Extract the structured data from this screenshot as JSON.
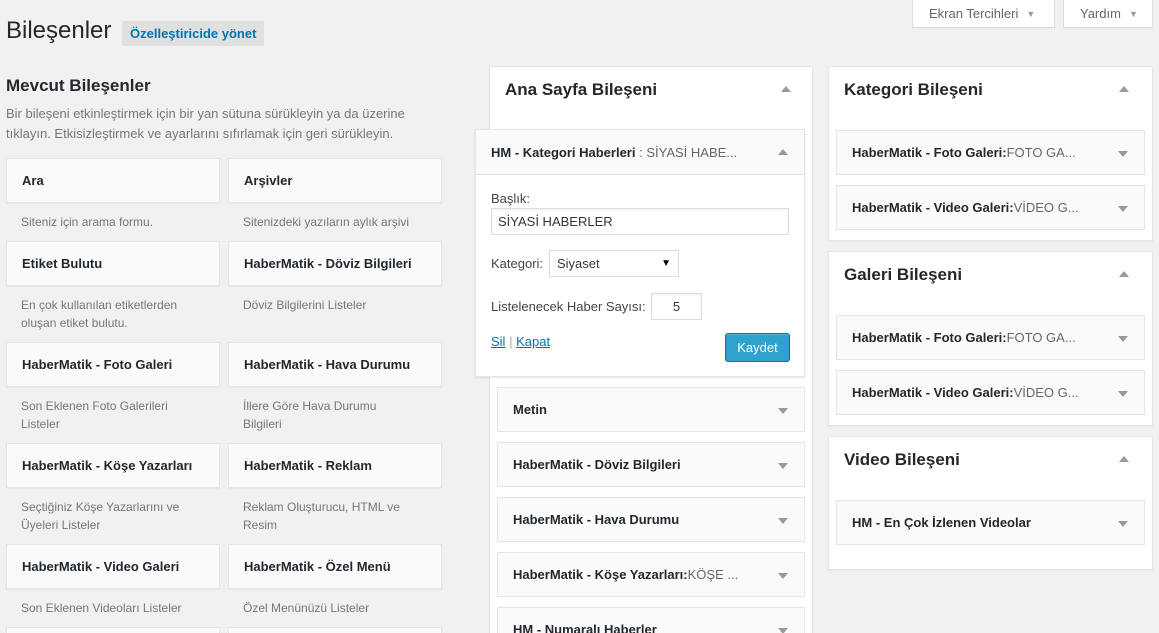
{
  "header": {
    "title": "Bileşenler",
    "manage_label": "Özelleştiricide yönet",
    "screen_options_label": "Ekran Tercihleri",
    "help_label": "Yardım"
  },
  "available": {
    "title": "Mevcut Bileşenler",
    "description": "Bir bileşeni etkinleştirmek için bir yan sütuna sürükleyin ya da üzerine tıklayın. Etkisizleştirmek ve ayarlarını sıfırlamak için geri sürükleyin.",
    "widgets": [
      {
        "name": "Ara",
        "desc": "Siteniz için arama formu."
      },
      {
        "name": "Arşivler",
        "desc": "Sitenizdeki yazıların aylık arşivi"
      },
      {
        "name": "Etiket Bulutu",
        "desc": "En çok kullanılan etiketlerden oluşan etiket bulutu."
      },
      {
        "name": "HaberMatik - Döviz Bilgileri",
        "desc": "Döviz Bilgilerini Listeler"
      },
      {
        "name": "HaberMatik - Foto Galeri",
        "desc": "Son Eklenen Foto Galerileri Listeler"
      },
      {
        "name": "HaberMatik - Hava Durumu",
        "desc": "İllere Göre Hava Durumu Bilgileri"
      },
      {
        "name": "HaberMatik - Köşe Yazarları",
        "desc": "Seçtiğiniz Köşe Yazarlarını ve Üyeleri Listeler"
      },
      {
        "name": "HaberMatik - Reklam",
        "desc": "Reklam Oluşturucu, HTML ve Resim"
      },
      {
        "name": "HaberMatik - Video Galeri",
        "desc": "Son Eklenen Videoları Listeler"
      },
      {
        "name": "HaberMatik - Özel Menü",
        "desc": "Özel Menünüzü Listeler"
      }
    ]
  },
  "home_sidebar": {
    "title": "Ana Sayfa Bileşeni",
    "expanded": {
      "title": "HM - Kategori Haberleri",
      "subtitle": ": SİYASİ HABE...",
      "title_label": "Başlık:",
      "title_value": "SİYASİ HABERLER",
      "category_label": "Kategori:",
      "category_value": "Siyaset",
      "count_label": "Listelenecek Haber Sayısı:",
      "count_value": "5",
      "delete_label": "Sil",
      "separator": "|",
      "close_label": "Kapat",
      "save_label": "Kaydet"
    },
    "widgets": [
      {
        "name": "Metin",
        "sub": ""
      },
      {
        "name": "HaberMatik - Döviz Bilgileri",
        "sub": ""
      },
      {
        "name": "HaberMatik - Hava Durumu",
        "sub": ""
      },
      {
        "name": "HaberMatik - Köşe Yazarları:",
        "sub": " KÖŞE ..."
      },
      {
        "name": "HM - Numaralı Haberler",
        "sub": ""
      }
    ]
  },
  "category_sidebar": {
    "title": "Kategori Bileşeni",
    "widgets": [
      {
        "name": "HaberMatik - Foto Galeri:",
        "sub": " FOTO GA..."
      },
      {
        "name": "HaberMatik - Video Galeri:",
        "sub": " VİDEO G..."
      }
    ]
  },
  "gallery_sidebar": {
    "title": "Galeri Bileşeni",
    "widgets": [
      {
        "name": "HaberMatik - Foto Galeri:",
        "sub": " FOTO GA..."
      },
      {
        "name": "HaberMatik - Video Galeri:",
        "sub": " VİDEO G..."
      }
    ]
  },
  "video_sidebar": {
    "title": "Video Bileşeni",
    "widgets": [
      {
        "name": "HM - En Çok İzlenen Videolar",
        "sub": ""
      }
    ]
  },
  "colors": {
    "accent": "#0073aa",
    "primary_button": "#2ea2cc",
    "background": "#f1f1f1"
  }
}
